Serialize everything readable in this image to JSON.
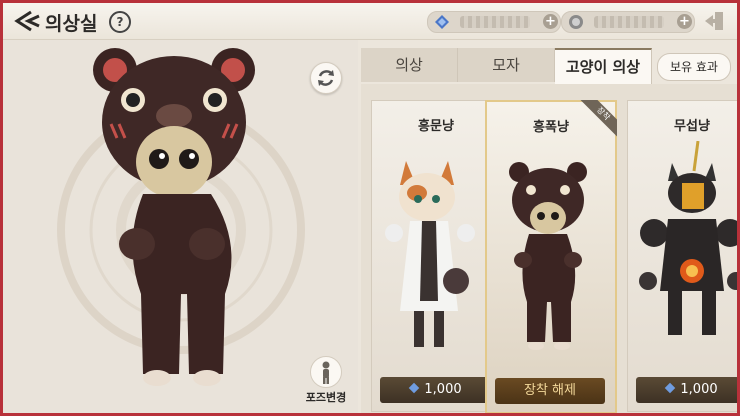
{
  "header": {
    "title": "의상실",
    "help_label": "?",
    "currency": [
      {
        "icon": "blue-gem-icon",
        "amount": "",
        "color": "#4a76c8"
      },
      {
        "icon": "coin-icon",
        "amount": "",
        "color": "#9a9a9a"
      }
    ]
  },
  "preview": {
    "pose_label": "포즈변경"
  },
  "tabs": [
    {
      "label": "의상",
      "active": false
    },
    {
      "label": "모자",
      "active": false
    },
    {
      "label": "고양이 의상",
      "active": true
    }
  ],
  "effect_button_label": "보유 효과",
  "costumes": [
    {
      "name": "흥문냥",
      "action": "1,000",
      "equipped": false
    },
    {
      "name": "흥폭냥",
      "action": "장착 해제",
      "equipped": true,
      "badge": "장착"
    },
    {
      "name": "무섭냥",
      "action": "1,000",
      "equipped": false
    }
  ],
  "colors": {
    "frame": "#b8313a",
    "background": "#ece6dc",
    "selected_border": "#e3c98a"
  }
}
